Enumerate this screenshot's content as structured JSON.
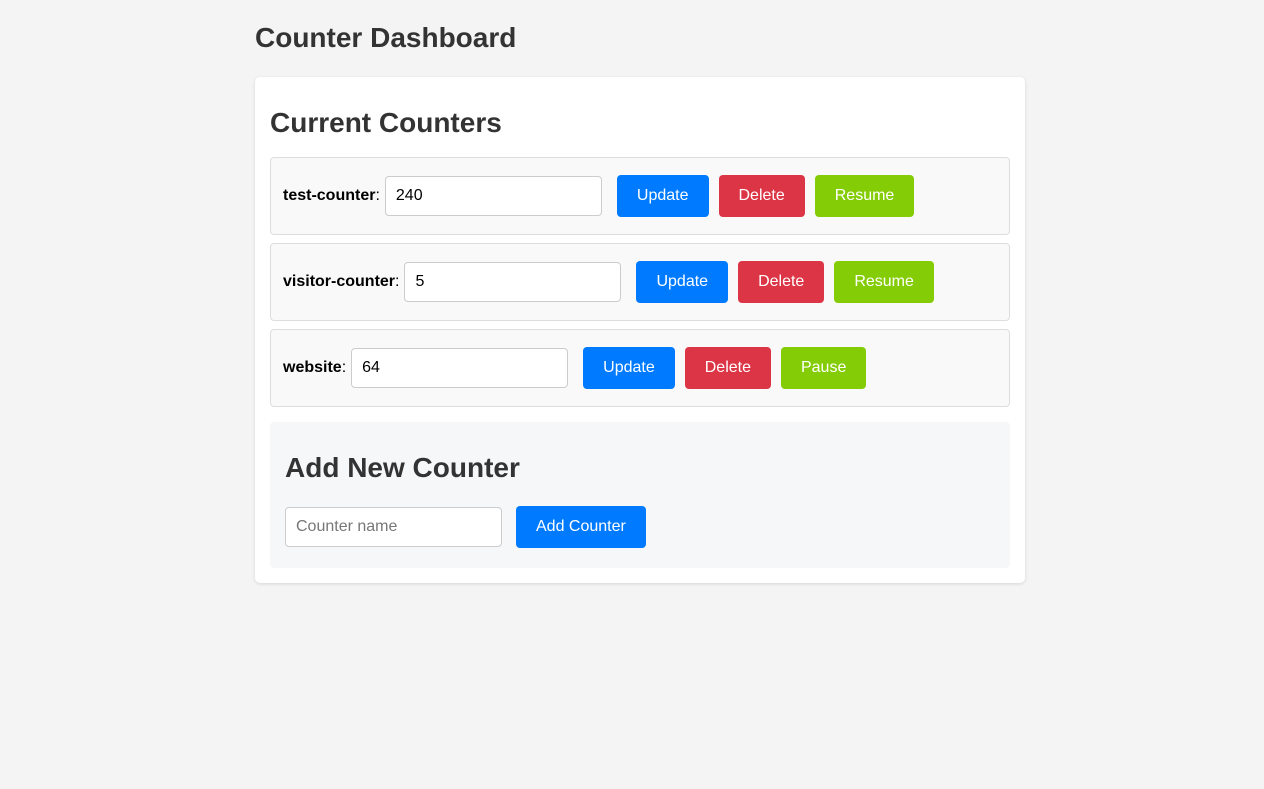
{
  "header": {
    "title": "Counter Dashboard"
  },
  "counters_section": {
    "title": "Current Counters",
    "counters": [
      {
        "name": "test-counter",
        "separator": ":",
        "value": "240",
        "update_label": "Update",
        "delete_label": "Delete",
        "toggle_label": "Resume"
      },
      {
        "name": "visitor-counter",
        "separator": ":",
        "value": "5",
        "update_label": "Update",
        "delete_label": "Delete",
        "toggle_label": "Resume"
      },
      {
        "name": "website",
        "separator": ":",
        "value": "64",
        "update_label": "Update",
        "delete_label": "Delete",
        "toggle_label": "Pause"
      }
    ]
  },
  "add_section": {
    "title": "Add New Counter",
    "name_placeholder": "Counter name",
    "name_value": "",
    "add_label": "Add Counter"
  },
  "colors": {
    "update": "#007bff",
    "delete": "#dc3545",
    "toggle": "#84cc05",
    "background": "#f4f4f4",
    "card": "#ffffff"
  }
}
